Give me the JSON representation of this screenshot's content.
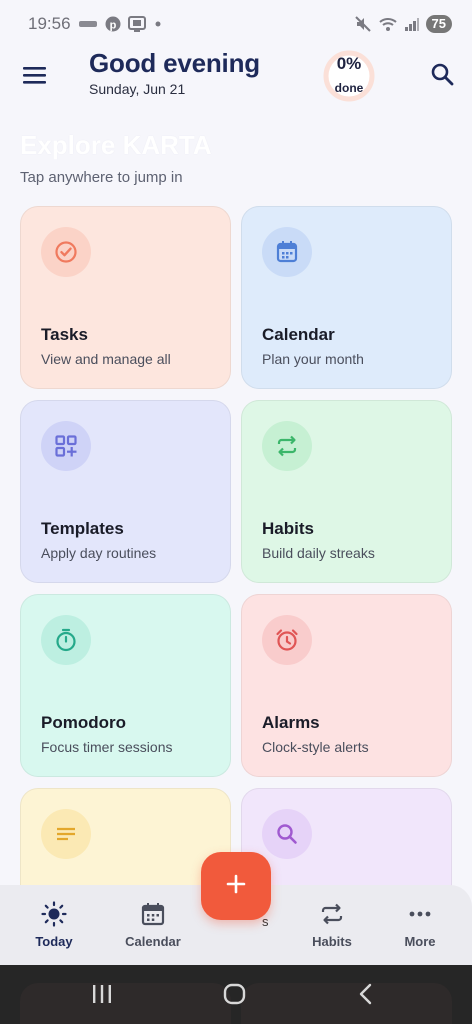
{
  "status_bar": {
    "time": "19:56",
    "battery": "75",
    "icons": [
      "notification-app-icon",
      "pinterest-icon",
      "media-icon",
      "dot-icon",
      "mute-icon",
      "wifi-icon",
      "signal-icon"
    ]
  },
  "header": {
    "greeting": "Good evening",
    "date": "Sunday, Jun 21",
    "progress_percent": "0%",
    "progress_label": "done",
    "progress_value": 0
  },
  "explore": {
    "title": "Explore KARTA",
    "subtitle": "Tap anywhere to jump in"
  },
  "cards": [
    {
      "title": "Tasks",
      "subtitle": "View and manage all",
      "icon": "check-circle-icon",
      "bg": "#fde6de",
      "circle": "#fbd3c7",
      "accent": "#f07a5e"
    },
    {
      "title": "Calendar",
      "subtitle": "Plan your month",
      "icon": "calendar-icon",
      "bg": "#deebfb",
      "circle": "#c9dbf7",
      "accent": "#4e7fd6"
    },
    {
      "title": "Templates",
      "subtitle": "Apply day routines",
      "icon": "grid-plus-icon",
      "bg": "#e3e6fb",
      "circle": "#cfd3f7",
      "accent": "#6a6fd8"
    },
    {
      "title": "Habits",
      "subtitle": "Build daily streaks",
      "icon": "repeat-icon",
      "bg": "#def7e6",
      "circle": "#c6f0d3",
      "accent": "#3bb66a"
    },
    {
      "title": "Pomodoro",
      "subtitle": "Focus timer sessions",
      "icon": "stopwatch-icon",
      "bg": "#d8f8ef",
      "circle": "#bdefe1",
      "accent": "#25a98a"
    },
    {
      "title": "Alarms",
      "subtitle": "Clock-style alerts",
      "icon": "alarm-icon",
      "bg": "#fde2e2",
      "circle": "#f9cccc",
      "accent": "#e05555"
    },
    {
      "title": "",
      "subtitle": "",
      "icon": "notes-lines-icon",
      "bg": "#fdf4d4",
      "circle": "#fbe9b4",
      "accent": "#e3a72b"
    },
    {
      "title": "",
      "subtitle": "",
      "icon": "search-icon",
      "bg": "#f1e6fb",
      "circle": "#e6d3f8",
      "accent": "#a05ad0"
    }
  ],
  "bottom_nav": {
    "items": [
      {
        "label": "Today",
        "icon": "sun-icon",
        "active": true
      },
      {
        "label": "Calendar",
        "icon": "calendar-icon",
        "active": false
      },
      {
        "label": "Habits",
        "icon": "repeat-icon",
        "active": false
      },
      {
        "label": "More",
        "icon": "more-dots-icon",
        "active": false
      }
    ],
    "partial_glyph": "s"
  },
  "fab": {
    "icon": "plus-icon",
    "color": "#f15a3c"
  },
  "system_nav": {
    "icons": [
      "recents-icon",
      "home-icon",
      "back-icon"
    ]
  }
}
